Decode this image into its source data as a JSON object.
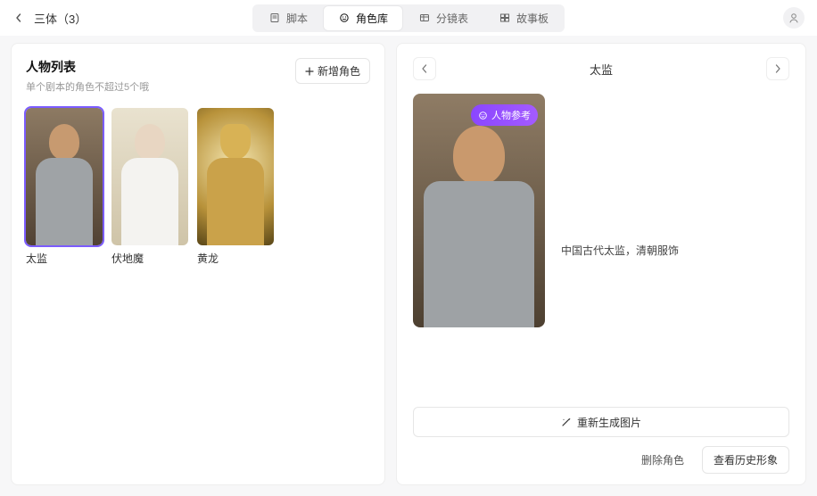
{
  "header": {
    "title": "三体（3）",
    "tabs": [
      {
        "label": "脚本",
        "icon": "script-icon"
      },
      {
        "label": "角色库",
        "icon": "face-icon",
        "active": true
      },
      {
        "label": "分镜表",
        "icon": "shotlist-icon"
      },
      {
        "label": "故事板",
        "icon": "storyboard-icon"
      }
    ]
  },
  "left": {
    "title": "人物列表",
    "subtitle": "单个剧本的角色不超过5个哦",
    "add_label": "新增角色",
    "characters": [
      {
        "name": "太监",
        "selected": true
      },
      {
        "name": "伏地魔",
        "selected": false
      },
      {
        "name": "黄龙",
        "selected": false
      }
    ]
  },
  "detail": {
    "name": "太监",
    "badge": "人物参考",
    "description": "中国古代太监，清朝服饰",
    "regen_label": "重新生成图片",
    "delete_label": "删除角色",
    "history_label": "查看历史形象"
  }
}
